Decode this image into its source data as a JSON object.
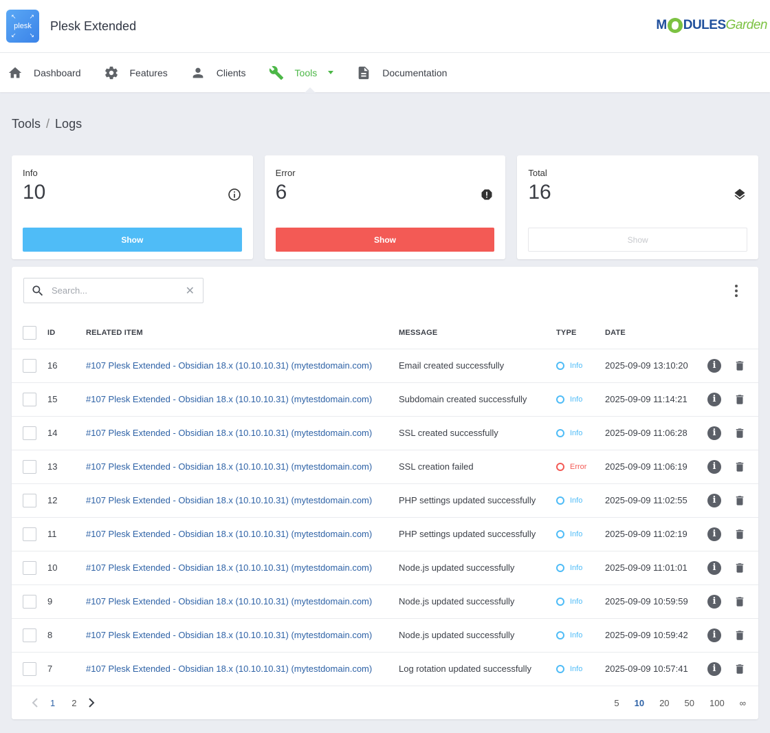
{
  "header": {
    "app_logo_text": "plesk",
    "app_title": "Plesk Extended",
    "brand_modules": "MODULES",
    "brand_garden": "Garden"
  },
  "nav": [
    {
      "label": "Dashboard",
      "icon": "home-icon"
    },
    {
      "label": "Features",
      "icon": "gear-icon"
    },
    {
      "label": "Clients",
      "icon": "user-icon"
    },
    {
      "label": "Tools",
      "icon": "wrench-icon",
      "active": true
    },
    {
      "label": "Documentation",
      "icon": "document-icon"
    }
  ],
  "breadcrumb": {
    "parent": "Tools",
    "separator": "/",
    "current": "Logs"
  },
  "cards": {
    "info": {
      "label": "Info",
      "value": "10",
      "button": "Show",
      "icon": "info-circle-icon",
      "color": "#4fbcf7"
    },
    "error": {
      "label": "Error",
      "value": "6",
      "button": "Show",
      "icon": "alert-octagon-icon",
      "color": "#f35a55"
    },
    "total": {
      "label": "Total",
      "value": "16",
      "button": "Show",
      "icon": "layers-icon"
    }
  },
  "search": {
    "placeholder": "Search..."
  },
  "table": {
    "headers": {
      "id": "ID",
      "related_item": "RELATED ITEM",
      "message": "MESSAGE",
      "type": "TYPE",
      "date": "DATE"
    },
    "rows": [
      {
        "id": "16",
        "item": "#107 Plesk Extended - Obsidian 18.x (10.10.10.31) (mytestdomain.com)",
        "message": "Email created successfully",
        "type": "Info",
        "date": "2025-09-09 13:10:20"
      },
      {
        "id": "15",
        "item": "#107 Plesk Extended - Obsidian 18.x (10.10.10.31) (mytestdomain.com)",
        "message": "Subdomain created successfully",
        "type": "Info",
        "date": "2025-09-09 11:14:21"
      },
      {
        "id": "14",
        "item": "#107 Plesk Extended - Obsidian 18.x (10.10.10.31) (mytestdomain.com)",
        "message": "SSL created successfully",
        "type": "Info",
        "date": "2025-09-09 11:06:28"
      },
      {
        "id": "13",
        "item": "#107 Plesk Extended - Obsidian 18.x (10.10.10.31) (mytestdomain.com)",
        "message": "SSL creation failed",
        "type": "Error",
        "date": "2025-09-09 11:06:19"
      },
      {
        "id": "12",
        "item": "#107 Plesk Extended - Obsidian 18.x (10.10.10.31) (mytestdomain.com)",
        "message": "PHP settings updated successfully",
        "type": "Info",
        "date": "2025-09-09 11:02:55"
      },
      {
        "id": "11",
        "item": "#107 Plesk Extended - Obsidian 18.x (10.10.10.31) (mytestdomain.com)",
        "message": "PHP settings updated successfully",
        "type": "Info",
        "date": "2025-09-09 11:02:19"
      },
      {
        "id": "10",
        "item": "#107 Plesk Extended - Obsidian 18.x (10.10.10.31) (mytestdomain.com)",
        "message": "Node.js updated successfully",
        "type": "Info",
        "date": "2025-09-09 11:01:01"
      },
      {
        "id": "9",
        "item": "#107 Plesk Extended - Obsidian 18.x (10.10.10.31) (mytestdomain.com)",
        "message": "Node.js updated successfully",
        "type": "Info",
        "date": "2025-09-09 10:59:59"
      },
      {
        "id": "8",
        "item": "#107 Plesk Extended - Obsidian 18.x (10.10.10.31) (mytestdomain.com)",
        "message": "Node.js updated successfully",
        "type": "Info",
        "date": "2025-09-09 10:59:42"
      },
      {
        "id": "7",
        "item": "#107 Plesk Extended - Obsidian 18.x (10.10.10.31) (mytestdomain.com)",
        "message": "Log rotation updated successfully",
        "type": "Info",
        "date": "2025-09-09 10:57:41"
      }
    ]
  },
  "pagination": {
    "pages": [
      "1",
      "2"
    ],
    "current_page": "1",
    "page_sizes": [
      "5",
      "10",
      "20",
      "50",
      "100",
      "∞"
    ],
    "current_size": "10"
  }
}
